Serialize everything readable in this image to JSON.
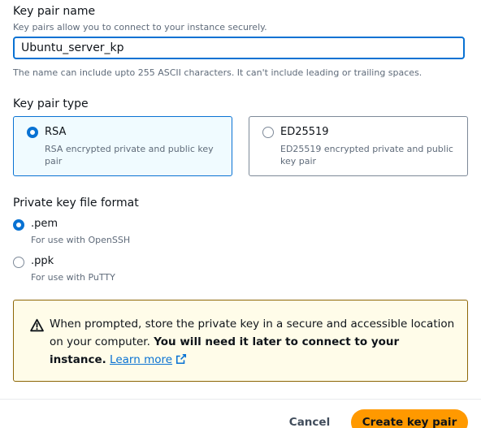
{
  "key_pair_name": {
    "label": "Key pair name",
    "description": "Key pairs allow you to connect to your instance securely.",
    "value": "Ubuntu_server_kp",
    "constraint": "The name can include upto 255 ASCII characters. It can't include leading or trailing spaces."
  },
  "key_pair_type": {
    "label": "Key pair type",
    "options": [
      {
        "title": "RSA",
        "description": "RSA encrypted private and public key pair",
        "selected": true
      },
      {
        "title": "ED25519",
        "description": "ED25519 encrypted private and public key pair",
        "selected": false
      }
    ]
  },
  "private_key_format": {
    "label": "Private key file format",
    "options": [
      {
        "title": ".pem",
        "description": "For use with OpenSSH",
        "selected": true
      },
      {
        "title": ".ppk",
        "description": "For use with PuTTY",
        "selected": false
      }
    ]
  },
  "alert": {
    "text_plain": "When prompted, store the private key in a secure and accessible location on your computer. ",
    "text_bold": "You will need it later to connect to your instance.",
    "link_text": "Learn more",
    "icon": "warning-icon"
  },
  "actions": {
    "cancel_label": "Cancel",
    "create_label": "Create key pair"
  },
  "colors": {
    "accent": "#0972d3",
    "primary_button": "#ff9900",
    "alert_background": "#fffce9",
    "alert_border": "#8d6605"
  }
}
